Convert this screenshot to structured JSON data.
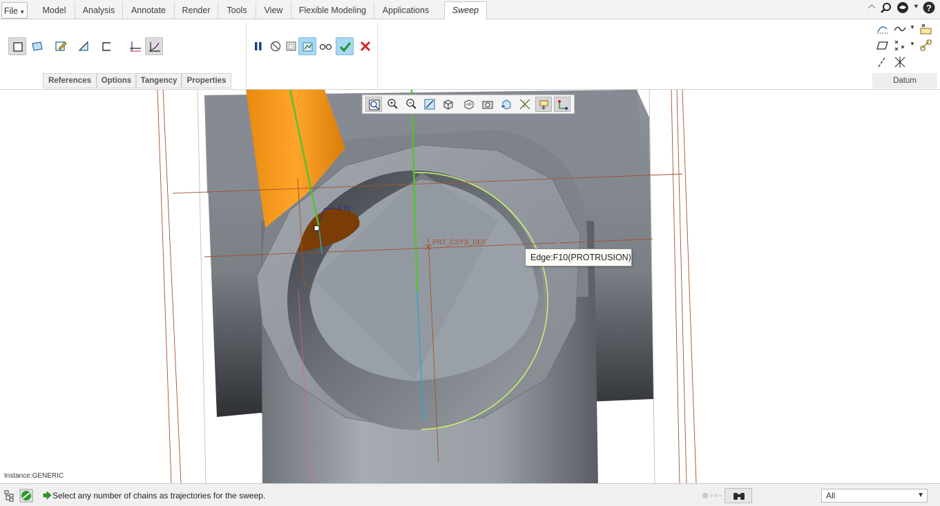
{
  "menubar": {
    "file_label": "File",
    "tabs": [
      "Model",
      "Analysis",
      "Annotate",
      "Render",
      "Tools",
      "View",
      "Flexible Modeling",
      "Applications"
    ],
    "active_tab": "Sweep"
  },
  "ribbon": {
    "slideup_tabs": [
      "References",
      "Options",
      "Tangency",
      "Properties"
    ],
    "datum_label": "Datum"
  },
  "viewport": {
    "tooltip": "Edge:F10(PROTRUSION)",
    "dimension_value": "4.70",
    "csys_label": "PRT_CSYS_DEF",
    "instance_label": "Instance:GENERIC"
  },
  "statusbar": {
    "message": "Select any number of chains as trajectories for the sweep.",
    "filter_value": "All"
  },
  "colors": {
    "accent": "#a9d8f2",
    "model_gray": "#8e939a",
    "sweep_orange": "#f29a1d",
    "trajectory_green": "#4fc52d",
    "edge_highlight": "#c9f06a",
    "ok_green": "#1f9a2a",
    "cancel_red": "#d62222"
  }
}
